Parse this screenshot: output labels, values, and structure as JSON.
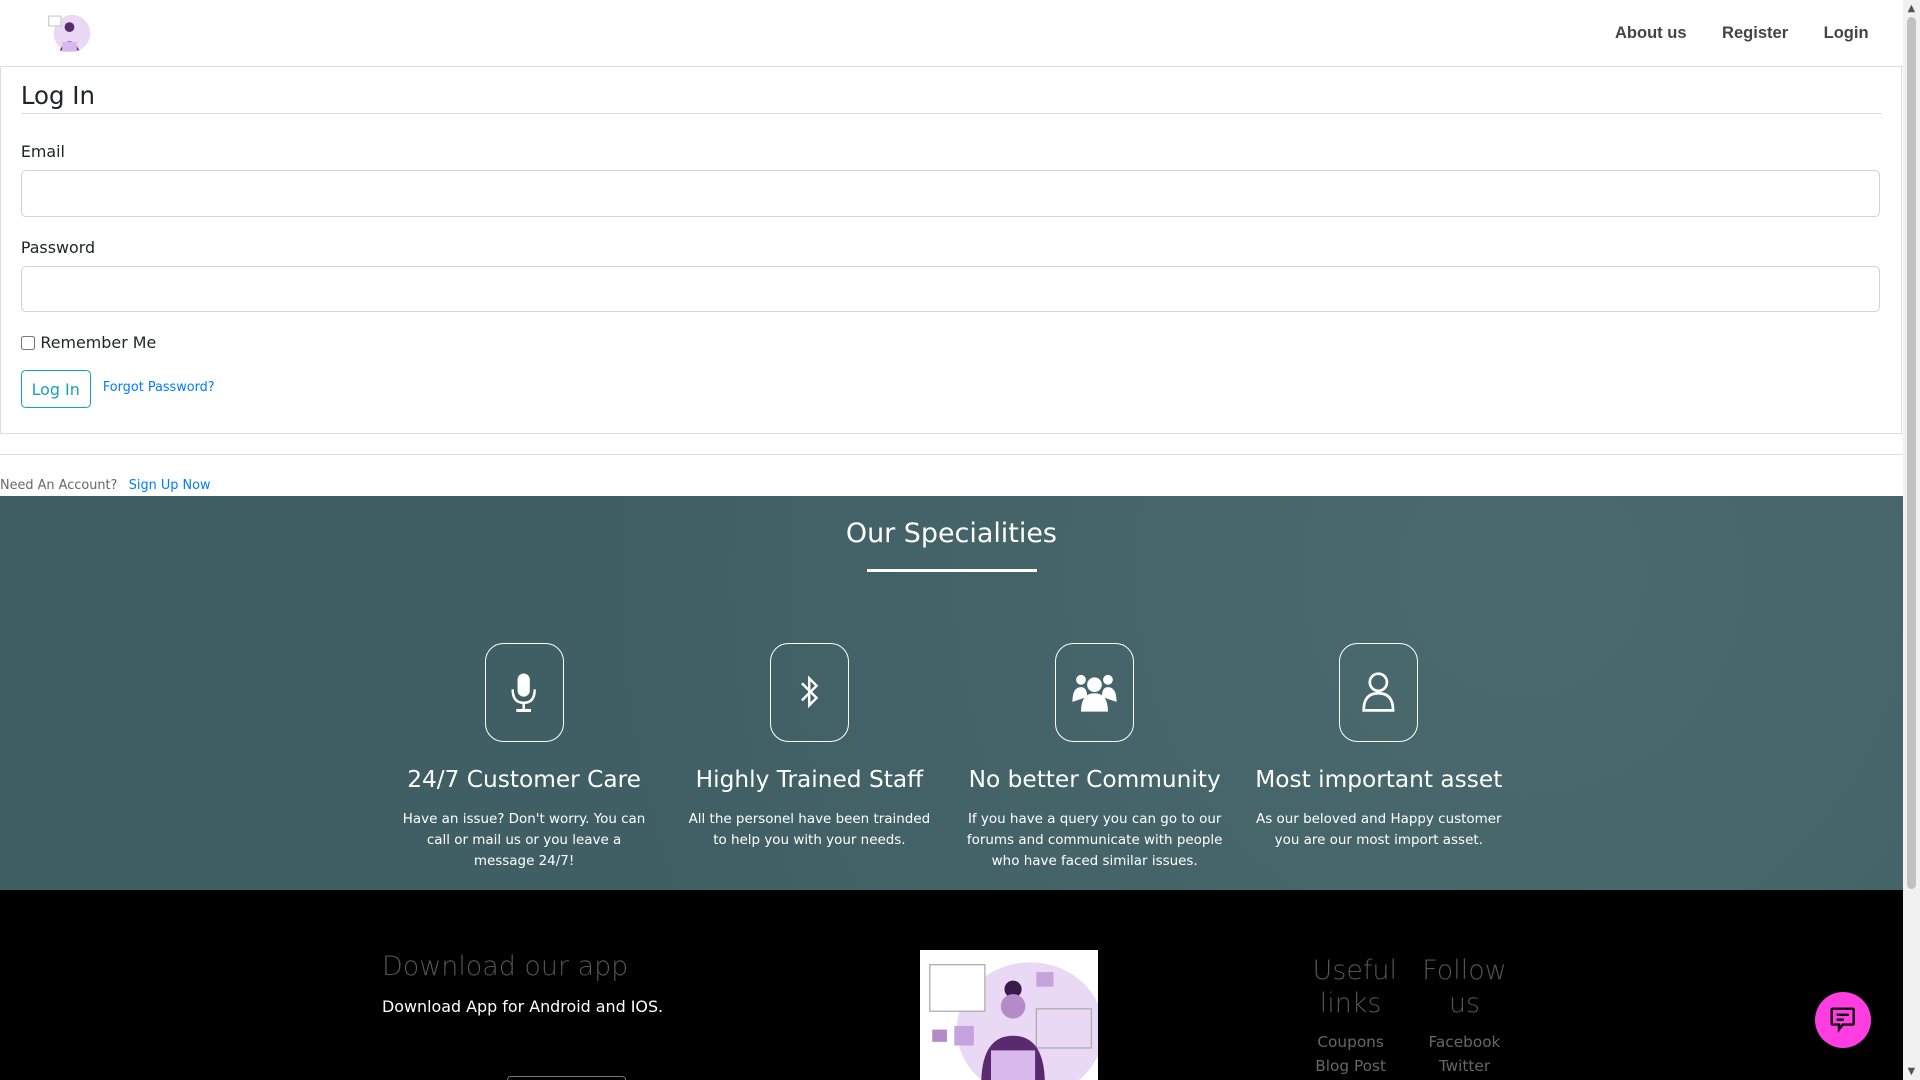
{
  "nav": {
    "about": "About us",
    "register": "Register",
    "login": "Login"
  },
  "form": {
    "title": "Log In",
    "email_label": "Email",
    "email_value": "",
    "password_label": "Password",
    "password_value": "",
    "remember": "Remember Me",
    "submit": "Log In",
    "forgot": "Forgot Password?"
  },
  "signup": {
    "prompt": "Need An Account?",
    "link": "Sign Up Now"
  },
  "specialities": {
    "title": "Our Specialities",
    "items": [
      {
        "icon": "microphone-icon",
        "title": "24/7 Customer Care",
        "text": "Have an issue? Don't worry. You can call or mail us or you leave a message 24/7!"
      },
      {
        "icon": "bluetooth-icon",
        "title": "Highly Trained Staff",
        "text": "All the personel have been trainded to help you with your needs."
      },
      {
        "icon": "users-icon",
        "title": "No better Community",
        "text": "If you have a query you can go to our forums and communicate with people who have faced similar issues."
      },
      {
        "icon": "user-icon",
        "title": "Most important asset",
        "text": "As our beloved and Happy customer you are our most import asset."
      }
    ]
  },
  "footer": {
    "download_title": "Download our app",
    "download_text": "Download App for Android and IOS.",
    "useful_title": "Useful links",
    "useful_links": [
      "Coupons",
      "Blog Post"
    ],
    "follow_title": "Follow us",
    "follow_links": [
      "Facebook",
      "Twitter"
    ]
  },
  "colors": {
    "accent": "#17a2b8",
    "link": "#007bff",
    "section_bg": "#3f5f64",
    "chat": "#ff3de0"
  }
}
